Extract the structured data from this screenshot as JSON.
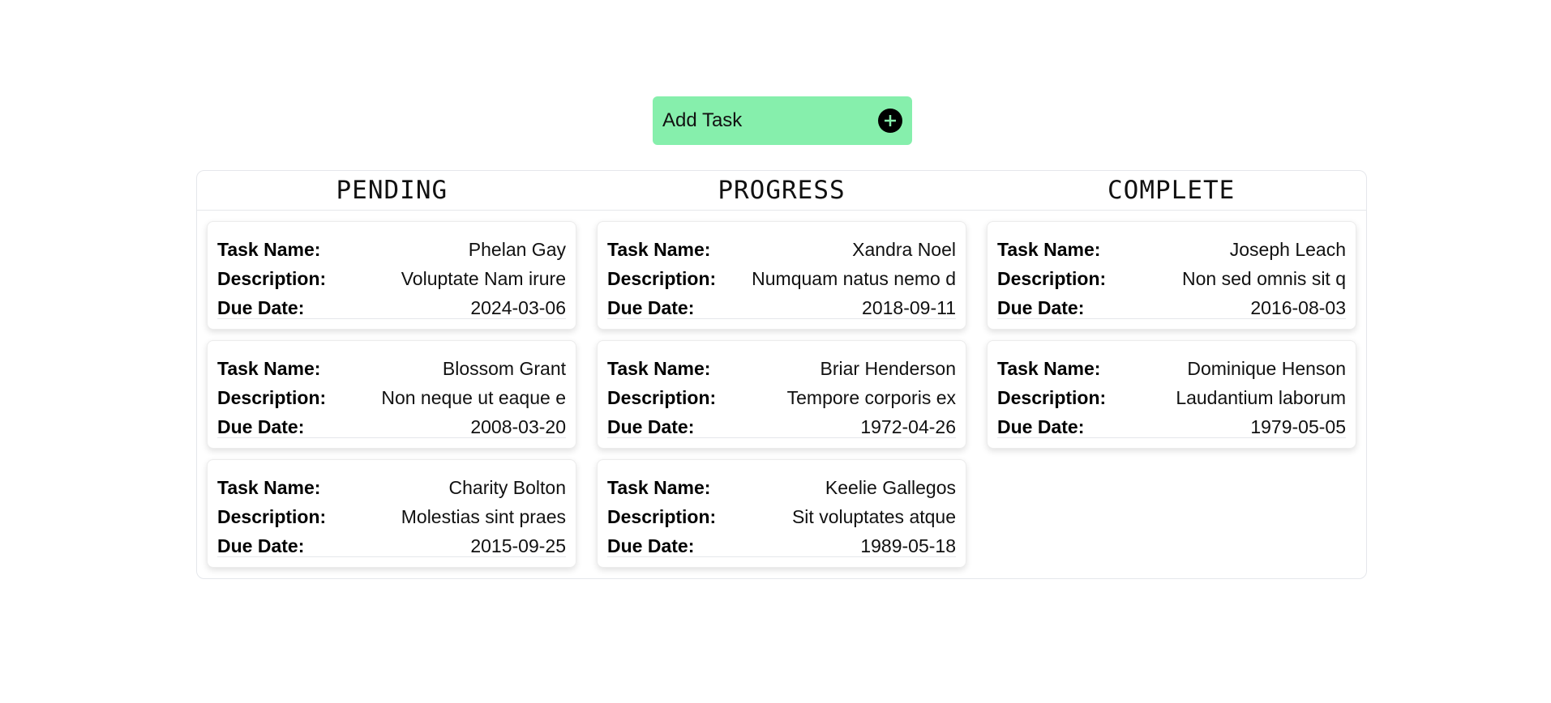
{
  "add_task": {
    "label": "Add Task",
    "icon": "plus-circle-icon",
    "color": "#86efac"
  },
  "columns": [
    {
      "title": "PENDING",
      "tasks": [
        {
          "name_label": "Task Name:",
          "name": "Phelan Gay",
          "desc_label": "Description:",
          "description": "Voluptate Nam irure",
          "due_label": "Due Date:",
          "due": "2024-03-06"
        },
        {
          "name_label": "Task Name:",
          "name": "Blossom Grant",
          "desc_label": "Description:",
          "description": "Non neque ut eaque e",
          "due_label": "Due Date:",
          "due": "2008-03-20"
        },
        {
          "name_label": "Task Name:",
          "name": "Charity Bolton",
          "desc_label": "Description:",
          "description": "Molestias sint praes",
          "due_label": "Due Date:",
          "due": "2015-09-25"
        }
      ]
    },
    {
      "title": "PROGRESS",
      "tasks": [
        {
          "name_label": "Task Name:",
          "name": "Xandra Noel",
          "desc_label": "Description:",
          "description": "Numquam natus nemo d",
          "due_label": "Due Date:",
          "due": "2018-09-11"
        },
        {
          "name_label": "Task Name:",
          "name": "Briar Henderson",
          "desc_label": "Description:",
          "description": "Tempore corporis ex",
          "due_label": "Due Date:",
          "due": "1972-04-26"
        },
        {
          "name_label": "Task Name:",
          "name": "Keelie Gallegos",
          "desc_label": "Description:",
          "description": "Sit voluptates atque",
          "due_label": "Due Date:",
          "due": "1989-05-18"
        }
      ]
    },
    {
      "title": "COMPLETE",
      "tasks": [
        {
          "name_label": "Task Name:",
          "name": "Joseph Leach",
          "desc_label": "Description:",
          "description": "Non sed omnis sit q",
          "due_label": "Due Date:",
          "due": "2016-08-03"
        },
        {
          "name_label": "Task Name:",
          "name": "Dominique Henson",
          "desc_label": "Description:",
          "description": "Laudantium laborum",
          "due_label": "Due Date:",
          "due": "1979-05-05"
        }
      ]
    }
  ]
}
